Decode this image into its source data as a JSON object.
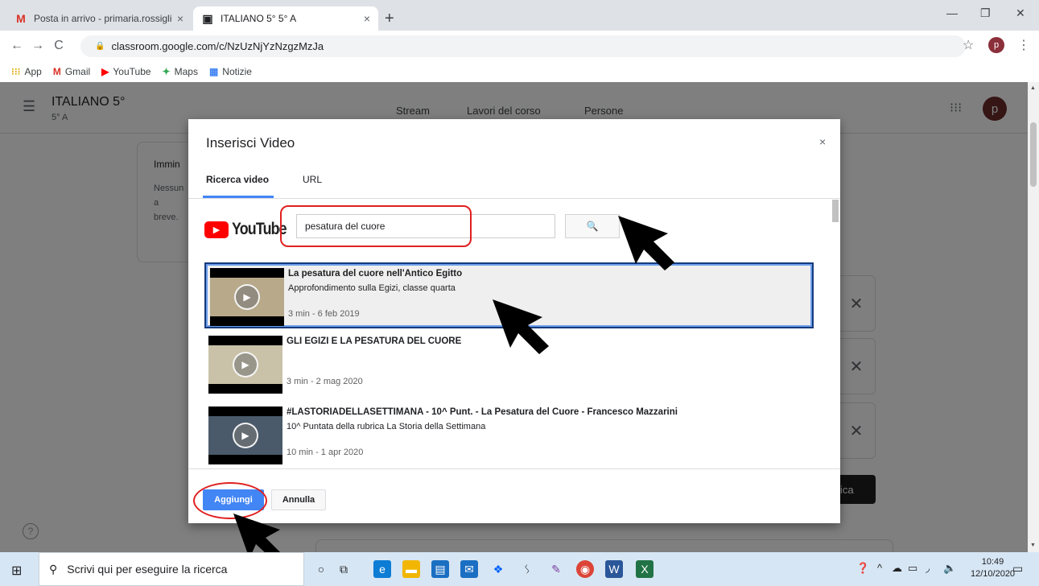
{
  "browser": {
    "tabs": [
      {
        "favicon": "M",
        "title": "Posta in arrivo - primaria.rossiglio",
        "close": "×"
      },
      {
        "favicon": "▣",
        "title": "ITALIANO 5° 5° A",
        "close": "×"
      }
    ],
    "new_tab": "+",
    "window_controls": {
      "minimize": "—",
      "restore": "❐",
      "close": "✕"
    },
    "nav": {
      "back": "←",
      "forward": "→",
      "reload": "C"
    },
    "url": "classroom.google.com/c/NzUzNjYzNzgzMzJa",
    "star": "☆",
    "profile_initial": "p",
    "menu": "⋮",
    "bookmarks": [
      {
        "icon": "grid-icon",
        "glyph": "⁝⁝⁝",
        "label": "App",
        "color": "#e0b020"
      },
      {
        "icon": "gmail-icon",
        "glyph": "M",
        "label": "Gmail",
        "color": "#d93025"
      },
      {
        "icon": "youtube-icon",
        "glyph": "▶",
        "label": "YouTube",
        "color": "#ff0000"
      },
      {
        "icon": "maps-icon",
        "glyph": "✦",
        "label": "Maps",
        "color": "#34a853"
      },
      {
        "icon": "news-icon",
        "glyph": "▦",
        "label": "Notizie",
        "color": "#4285f4"
      }
    ]
  },
  "classroom": {
    "class_name": "ITALIANO 5°",
    "section": "5° A",
    "nav_tabs": [
      "Stream",
      "Lavori del corso",
      "Persone"
    ],
    "avatar_initial": "p",
    "bg_card_heading": "Immin",
    "bg_card_text_1": "Nessun",
    "bg_card_text_2": "a breve.",
    "publish_label": "ica",
    "help_glyph": "?"
  },
  "dialog": {
    "title": "Inserisci Video",
    "close": "×",
    "tabs": [
      "Ricerca video",
      "URL"
    ],
    "youtube_wordmark": "YouTube",
    "search_value": "pesatura del cuore",
    "search_icon": "🔍",
    "results": [
      {
        "title": "La pesatura del cuore nell'Antico Egitto",
        "description": "Approfondimento sulla Egizi, classe quarta",
        "meta": "3 min - 6 feb 2019",
        "thumb_bg": "#b8a98a",
        "selected": true
      },
      {
        "title": "GLI EGIZI E LA PESATURA DEL CUORE",
        "description": "",
        "meta": "3 min - 2 mag 2020",
        "thumb_bg": "#c9c2a8",
        "selected": false
      },
      {
        "title": "#LASTORIADELLASETTIMANA - 10^ Punt. - La Pesatura del Cuore - Francesco Mazzarini",
        "description": "10^ Puntata della rubrica La Storia della Settimana",
        "meta": "10 min - 1 apr 2020",
        "thumb_bg": "#4a5a6a",
        "selected": false
      }
    ],
    "add_button": "Aggiungi",
    "cancel_button": "Annulla"
  },
  "taskbar": {
    "search_placeholder": "Scrivi qui per eseguire la ricerca",
    "time": "10:49",
    "date": "12/10/2020"
  },
  "colors": {
    "accent_blue": "#4285f4",
    "highlight_red": "#e02020",
    "selection_border": "#153a7b"
  }
}
